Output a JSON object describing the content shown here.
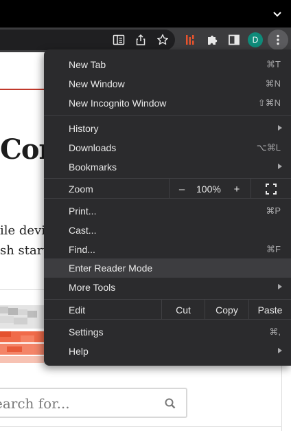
{
  "toolbar": {
    "profile_initial": "D"
  },
  "page": {
    "heading_fragment": "Cor",
    "para_line1": "ile devic",
    "para_line2": "sh start.",
    "search_placeholder": "earch for..."
  },
  "menu": {
    "new_tab": {
      "label": "New Tab",
      "shortcut": "⌘T"
    },
    "new_window": {
      "label": "New Window",
      "shortcut": "⌘N"
    },
    "new_incognito": {
      "label": "New Incognito Window",
      "shortcut": "⇧⌘N"
    },
    "history": {
      "label": "History"
    },
    "downloads": {
      "label": "Downloads",
      "shortcut": "⌥⌘L"
    },
    "bookmarks": {
      "label": "Bookmarks"
    },
    "zoom": {
      "label": "Zoom",
      "minus": "–",
      "value": "100%",
      "plus": "+"
    },
    "print": {
      "label": "Print...",
      "shortcut": "⌘P"
    },
    "cast": {
      "label": "Cast..."
    },
    "find": {
      "label": "Find...",
      "shortcut": "⌘F"
    },
    "reader_mode": {
      "label": "Enter Reader Mode"
    },
    "more_tools": {
      "label": "More Tools"
    },
    "edit": {
      "label": "Edit",
      "cut": "Cut",
      "copy": "Copy",
      "paste": "Paste"
    },
    "settings": {
      "label": "Settings",
      "shortcut": "⌘,"
    },
    "help": {
      "label": "Help"
    }
  },
  "colors": {
    "menu_bg": "#2b2b2d",
    "highlight": "#3d3d40",
    "avatar": "#0f8b7a",
    "accent_red": "#c0392b"
  }
}
